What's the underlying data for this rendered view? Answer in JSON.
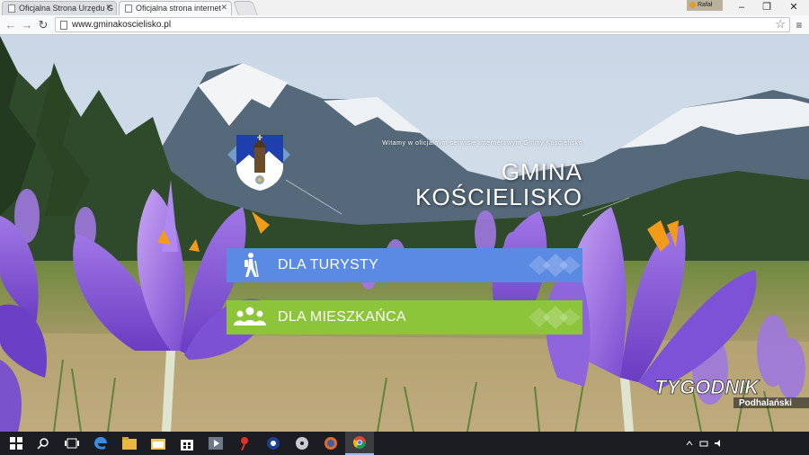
{
  "browser": {
    "tabs": [
      {
        "title": "Oficjalna Strona Urzędu G",
        "active": false
      },
      {
        "title": "Oficjalna strona internet",
        "active": true
      }
    ],
    "user": "Rafał",
    "url": "www.gminakoscielisko.pl",
    "window_controls": {
      "minimize": "–",
      "restore": "❐",
      "close": "✕"
    }
  },
  "site": {
    "welcome": "Witamy w oficjalnym serwisie internetowym Gminy Kościelisko",
    "name_line1": "GMINA",
    "name_line2": "KOŚCIELISKO",
    "buttons": [
      {
        "label": "DLA TURYSTY",
        "color": "#5b8ae3",
        "icon": "hiker-icon"
      },
      {
        "label": "DLA MIESZKAŃCA",
        "color": "#8cc43a",
        "icon": "people-icon"
      }
    ]
  },
  "watermark": {
    "line1": "TYGODNIK",
    "line2": "Podhalański"
  },
  "taskbar": {
    "items": [
      "windows-start-icon",
      "search-icon",
      "task-view-icon",
      "edge-icon",
      "file-explorer-icon",
      "folder-icon",
      "store-icon",
      "media-player-icon",
      "pin-icon",
      "app-icon",
      "dvd-icon",
      "firefox-icon",
      "chrome-icon"
    ]
  }
}
